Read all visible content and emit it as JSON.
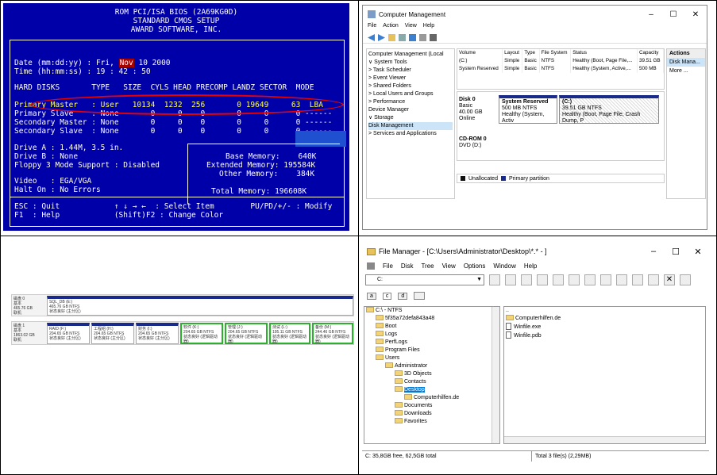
{
  "bios": {
    "header": [
      "ROM PCI/ISA BIOS (2A69KG0D)",
      "STANDARD CMOS SETUP",
      "AWARD SOFTWARE, INC."
    ],
    "date_label": "Date (mm:dd:yy) : Fri,",
    "date_month": "Nov",
    "date_rest": " 10 2000",
    "time_line": "Time (hh:mm:ss) : 19 : 42 : 50",
    "table_header": "HARD DISKS       TYPE   SIZE  CYLS HEAD PRECOMP LANDZ SECTOR  MODE",
    "rows": [
      "Primary Master   : User   10134  1232  256       0 19649     63  LBA",
      "Primary Slave    : None       0     0    0       0     0      0 ------",
      "Secondary Master : None       0     0    0       0     0      0 ------",
      "Secondary Slave  : None       0     0    0       0     0      0 ------"
    ],
    "drive_a": "Drive A : 1.44M, 3.5 in.",
    "drive_b": "Drive B : None",
    "floppy": "Floppy 3 Mode Support : Disabled",
    "video": "Video   : EGA/VGA",
    "halt": "Halt On : No Errors",
    "base_mem": "Base Memory:    640K",
    "ext_mem": "Extended Memory: 195584K",
    "other_mem": "Other Memory:    384K",
    "total_mem": "Total Memory: 196608K",
    "footer1": "ESC : Quit            ↑ ↓ → ←  : Select Item        PU/PD/+/- : Modify",
    "footer2": "F1  : Help            (Shift)F2 : Change Color"
  },
  "cm": {
    "title": "Computer Management",
    "menu": [
      "File",
      "Action",
      "View",
      "Help"
    ],
    "tree": [
      "Computer Management (Local",
      "∨ System Tools",
      "   > Task Scheduler",
      "   > Event Viewer",
      "   > Shared Folders",
      "   > Local Users and Groups",
      "   > Performance",
      "     Device Manager",
      "∨ Storage",
      "     Disk Management",
      "> Services and Applications"
    ],
    "columns": [
      "Volume",
      "Layout",
      "Type",
      "File System",
      "Status",
      "Capacity"
    ],
    "volumes": [
      [
        "(C:)",
        "Simple",
        "Basic",
        "NTFS",
        "Healthy (Boot, Page File,...",
        "39.51 GB"
      ],
      [
        "System Reserved",
        "Simple",
        "Basic",
        "NTFS",
        "Healthy (System, Active,...",
        "500 MB"
      ]
    ],
    "disk0": [
      "Disk 0",
      "Basic",
      "40.00 GB",
      "Online"
    ],
    "part1": [
      "System Reserved",
      "500 MB NTFS",
      "Healthy (System, Activ"
    ],
    "part2": [
      "(C:)",
      "39.51 GB NTFS",
      "Healthy (Boot, Page File, Crash Dump, P"
    ],
    "cdrom": [
      "CD-ROM 0",
      "DVD (D:)"
    ],
    "legend": [
      "Unallocated",
      "Primary partition"
    ],
    "actions": [
      "Actions",
      "Disk Mana...",
      "More ..."
    ]
  },
  "dm": {
    "disk0": [
      "磁盘 0",
      "基本",
      "465.76 GB",
      "联机"
    ],
    "disk0_part": [
      "SQL_DB (E:)",
      "465.76 GB NTFS",
      "状态良好 (主分区)"
    ],
    "disk1": [
      "磁盘 1",
      "基本",
      "1863.02 GB",
      "联机"
    ],
    "disk1_parts": [
      [
        "RAID (F:)",
        "204.65 GB NTFS",
        "状态良好 (主分区)"
      ],
      [
        "工程组 (H:)",
        "204.65 GB NTFS",
        "状态良好 (主分区)"
      ],
      [
        "财务 (I:)",
        "204.65 GB NTFS",
        "状态良好 (主分区)"
      ],
      [
        "软件 (K:)",
        "204.65 GB NTFS",
        "状态良好 (逻辑驱动器)"
      ],
      [
        "管理 (J:)",
        "204.65 GB NTFS",
        "状态良好 (逻辑驱动器)"
      ],
      [
        "测试 (L:)",
        "195.11 GB NTFS",
        "状态良好 (逻辑驱动器)"
      ],
      [
        "备份 (M:)",
        "244.46 GB NTFS",
        "状态良好 (逻辑驱动器)"
      ]
    ]
  },
  "fm": {
    "title": "File Manager - [C:\\Users\\Administrator\\Desktop\\*.* - ]",
    "menu": [
      "File",
      "Disk",
      "Tree",
      "View",
      "Options",
      "Window",
      "Help"
    ],
    "drive": "C:",
    "drives": [
      "a",
      "c",
      "d",
      ""
    ],
    "tree": [
      "C:\\ - NTFS",
      "5f35a72defa843a48",
      "Boot",
      "Logs",
      "PerfLogs",
      "Program Files",
      "Users",
      "Administrator",
      "3D Objects",
      "Contacts",
      "Desktop",
      "Computerhilfen.de",
      "Documents",
      "Downloads",
      "Favorites"
    ],
    "files": [
      "..",
      "Computerhilfen.de",
      "Winfile.exe",
      "Winfile.pdb"
    ],
    "status_left": "C: 35,8GB free,  62,5GB total",
    "status_right": "Total 3 file(s) (2,29MB)"
  }
}
